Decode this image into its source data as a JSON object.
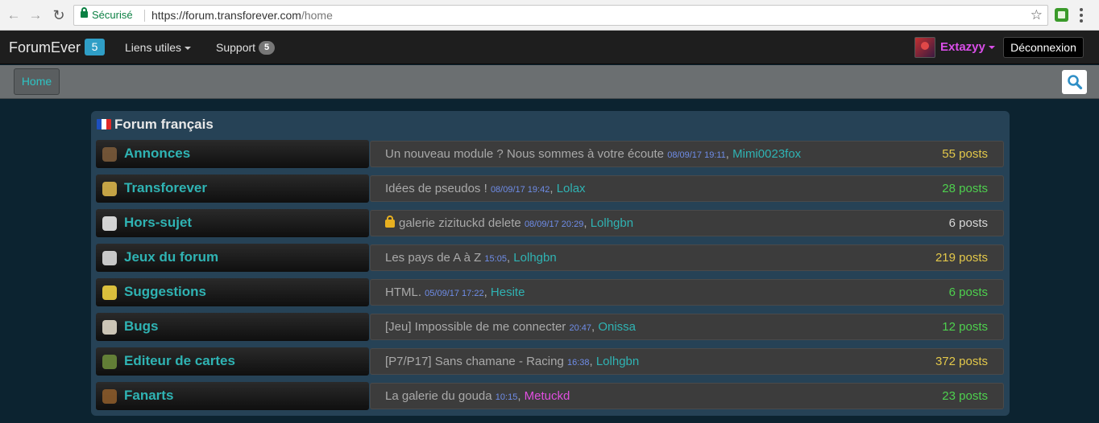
{
  "browser": {
    "secure_label": "Sécurisé",
    "url_host": "https://forum.transforever.com",
    "url_path": "/home"
  },
  "navbar": {
    "brand": "ForumEver",
    "brand_badge": "5",
    "links_label": "Liens utiles",
    "support_label": "Support",
    "support_badge": "5",
    "username": "Extazyy",
    "logout_label": "Déconnexion"
  },
  "subbar": {
    "home_label": "Home"
  },
  "forum": {
    "section_title": "Forum français",
    "categories": [
      {
        "title": "Annonces",
        "icon": "megaphone-icon",
        "last_post": "Un nouveau module ? Nous sommes à votre écoute",
        "date": "08/09/17 19:11",
        "author": "Mimi0023fox",
        "posts": "55 posts",
        "posts_color": "#e3c84a"
      },
      {
        "title": "Transforever",
        "icon": "cheese-icon",
        "last_post": "Idées de pseudos !",
        "date": "08/09/17 19:42",
        "author": "Lolax",
        "posts": "28 posts",
        "posts_color": "#4ed04e"
      },
      {
        "title": "Hors-sujet",
        "icon": "speech-bubble-icon",
        "last_post": "galerie zizituckd delete",
        "locked": true,
        "date": "08/09/17 20:29",
        "author": "Lolhgbn",
        "posts": "6 posts",
        "posts_color": "#d8d8d8"
      },
      {
        "title": "Jeux du forum",
        "icon": "dice-icon",
        "last_post": "Les pays de A à Z",
        "date": "15:05",
        "author": "Lolhgbn",
        "posts": "219 posts",
        "posts_color": "#e3c84a"
      },
      {
        "title": "Suggestions",
        "icon": "lightbulb-icon",
        "last_post": "HTML.",
        "date": "05/09/17 17:22",
        "author": "Hesite",
        "posts": "6 posts",
        "posts_color": "#4ed04e"
      },
      {
        "title": "Bugs",
        "icon": "skull-icon",
        "last_post": "[Jeu] Impossible de me connecter",
        "date": "20:47",
        "author": "Onissa",
        "posts": "12 posts",
        "posts_color": "#4ed04e"
      },
      {
        "title": "Editeur de cartes",
        "icon": "map-editor-icon",
        "last_post": "[P7/P17] Sans chamane - Racing",
        "date": "16:38",
        "author": "Lolhgbn",
        "posts": "372 posts",
        "posts_color": "#e3c84a"
      },
      {
        "title": "Fanarts",
        "icon": "paintbrush-icon",
        "last_post": "La galerie du gouda",
        "date": "10:15",
        "author": "Metuckd",
        "author_color": "#e04fe0",
        "posts": "23 posts",
        "posts_color": "#4ed04e"
      }
    ]
  }
}
